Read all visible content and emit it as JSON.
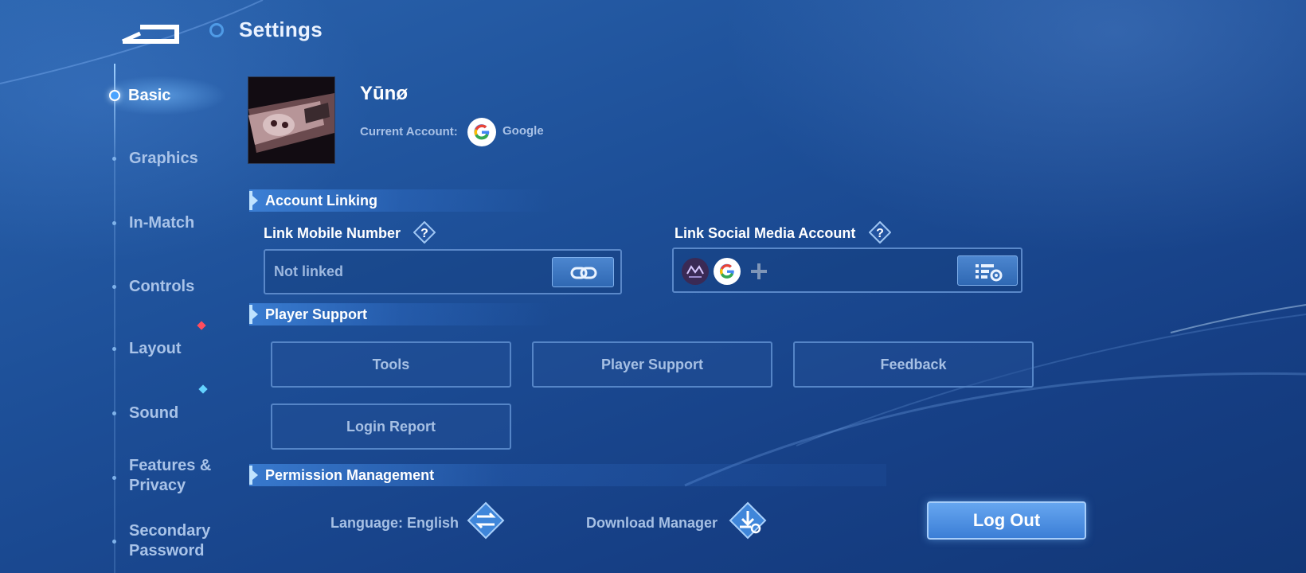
{
  "header": {
    "title": "Settings"
  },
  "sidebar": {
    "items": [
      {
        "label": "Basic",
        "active": true
      },
      {
        "label": "Graphics"
      },
      {
        "label": "In-Match"
      },
      {
        "label": "Controls"
      },
      {
        "label": "Layout",
        "badge": "red"
      },
      {
        "label": "Sound",
        "badge": "cyan"
      },
      {
        "label": "Features &",
        "label2": "Privacy"
      },
      {
        "label": "Secondary",
        "label2": "Password"
      }
    ]
  },
  "profile": {
    "username": "Yūnø",
    "account_label": "Current Account:",
    "account_provider": "Google",
    "account_icon": "google-icon"
  },
  "account_linking": {
    "title": "Account Linking",
    "mobile": {
      "label": "Link Mobile Number",
      "value": "Not linked",
      "button_icon": "link-icon"
    },
    "social": {
      "label": "Link Social Media Account",
      "linked_icons": [
        "moonton-icon",
        "google-icon"
      ],
      "add_icon": "plus-icon",
      "manage_icon": "list-settings-icon"
    }
  },
  "player_support": {
    "title": "Player Support",
    "buttons": [
      "Tools",
      "Player Support",
      "Feedback",
      "Login Report"
    ]
  },
  "permission": {
    "title": "Permission Management"
  },
  "footer": {
    "language_label": "Language: English",
    "language_icon": "swap-icon",
    "download_label": "Download Manager",
    "download_icon": "download-settings-icon",
    "logout_label": "Log Out"
  },
  "colors": {
    "accent": "#3b7ed6",
    "badge_red": "#ff4d5e",
    "badge_cyan": "#64d3ff",
    "background": "#1d4f98"
  }
}
